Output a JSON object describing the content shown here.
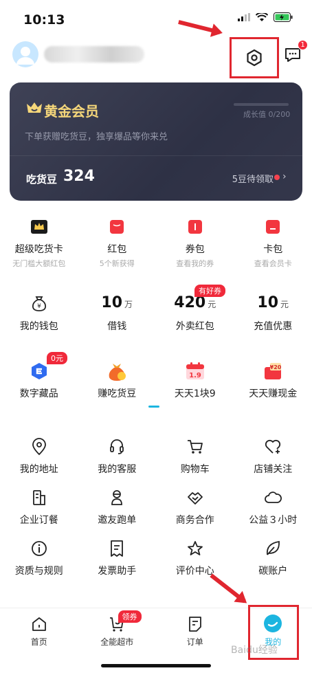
{
  "status_bar": {
    "time": "10:13"
  },
  "header": {
    "message_badge": "1"
  },
  "member_card": {
    "title": "黄金会员",
    "growth_label": "成长值 0/200",
    "description": "下单获赠吃货豆，独享爆品等你来兑",
    "beans_label": "吃货豆",
    "beans_value": "324",
    "beans_pending": "5豆待领取"
  },
  "cards_row": [
    {
      "label": "超级吃货卡",
      "sub": "无门槛大额红包",
      "icon": "crown-card-icon"
    },
    {
      "label": "红包",
      "sub": "5个新获得",
      "icon": "red-envelope-icon"
    },
    {
      "label": "券包",
      "sub": "查看我的券",
      "icon": "coupon-icon"
    },
    {
      "label": "卡包",
      "sub": "查看会员卡",
      "icon": "card-wallet-icon"
    }
  ],
  "money_row": [
    {
      "label": "我的钱包",
      "icon": "wallet-icon"
    },
    {
      "label": "借钱",
      "value": "10",
      "unit": "万"
    },
    {
      "label": "外卖红包",
      "value": "420",
      "unit": "元",
      "tag": "有好券"
    },
    {
      "label": "充值优惠",
      "value": "10",
      "unit": "元"
    }
  ],
  "promo_row": [
    {
      "label": "数字藏品",
      "tag": "0元",
      "icon": "digital-collectible-icon"
    },
    {
      "label": "赚吃货豆",
      "icon": "money-bag-icon"
    },
    {
      "label": "天天1块9",
      "icon": "calendar-deal-icon"
    },
    {
      "label": "天天赚现金",
      "icon": "cash-envelope-icon"
    }
  ],
  "service_rows": [
    [
      {
        "label": "我的地址",
        "icon": "location-pin-icon"
      },
      {
        "label": "我的客服",
        "icon": "headset-icon"
      },
      {
        "label": "购物车",
        "icon": "cart-icon"
      },
      {
        "label": "店铺关注",
        "icon": "heart-plus-icon"
      }
    ],
    [
      {
        "label": "企业订餐",
        "icon": "building-icon"
      },
      {
        "label": "邀友跑单",
        "icon": "rider-icon"
      },
      {
        "label": "商务合作",
        "icon": "handshake-icon"
      },
      {
        "label": "公益３小时",
        "icon": "cloud-heart-icon"
      }
    ],
    [
      {
        "label": "资质与规则",
        "icon": "info-icon"
      },
      {
        "label": "发票助手",
        "icon": "invoice-icon"
      },
      {
        "label": "评价中心",
        "icon": "star-icon"
      },
      {
        "label": "碳账户",
        "icon": "leaf-icon"
      }
    ]
  ],
  "tabbar": [
    {
      "label": "首页",
      "icon": "home-icon"
    },
    {
      "label": "全能超市",
      "icon": "supermarket-cart-icon",
      "tag": "领券"
    },
    {
      "label": "订单",
      "icon": "order-icon"
    },
    {
      "label": "我的",
      "icon": "profile-tab-icon",
      "active": true
    }
  ],
  "watermark": "Baidu经验",
  "colors": {
    "accent": "#1cb5e0",
    "badge": "#f0293a",
    "card_bg": "#2e3145",
    "gold": "#f6d77a",
    "highlight_frame": "#e0262f"
  }
}
